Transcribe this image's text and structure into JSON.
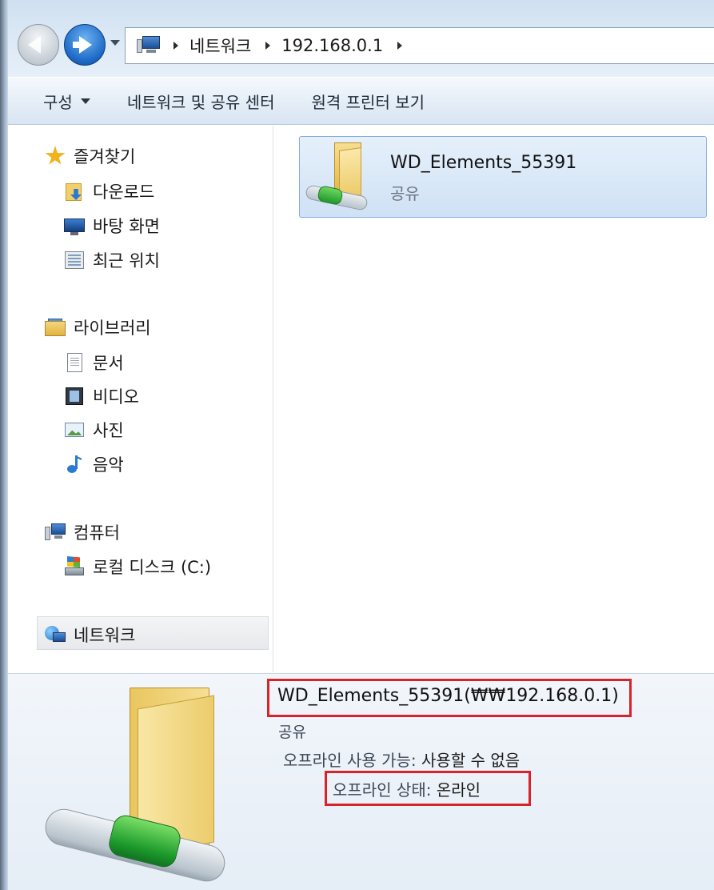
{
  "address_bar": {
    "crumbs": [
      "네트워크",
      "192.168.0.1"
    ]
  },
  "toolbar": {
    "organize": "구성",
    "network_sharing_center": "네트워크 및 공유 센터",
    "remote_printers": "원격 프린터 보기"
  },
  "nav": {
    "favorites": {
      "label": "즐겨찾기",
      "items": [
        "다운로드",
        "바탕 화면",
        "최근 위치"
      ]
    },
    "libraries": {
      "label": "라이브러리",
      "items": [
        "문서",
        "비디오",
        "사진",
        "음악"
      ]
    },
    "computer": {
      "label": "컴퓨터",
      "items": [
        "로컬 디스크 (C:)"
      ]
    },
    "network": {
      "label": "네트워크"
    }
  },
  "content": {
    "item": {
      "name": "WD_Elements_55391",
      "type": "공유"
    }
  },
  "details": {
    "title": "WD_Elements_55391(₩₩192.168.0.1)",
    "type": "공유",
    "offline_availability_label": "오프라인 사용 가능:",
    "offline_availability_value": "사용할 수 없음",
    "offline_status_label": "오프라인 상태:",
    "offline_status_value": "온라인"
  },
  "colors": {
    "highlight_box": "#d8232a",
    "selection": "#cfe1f5"
  }
}
